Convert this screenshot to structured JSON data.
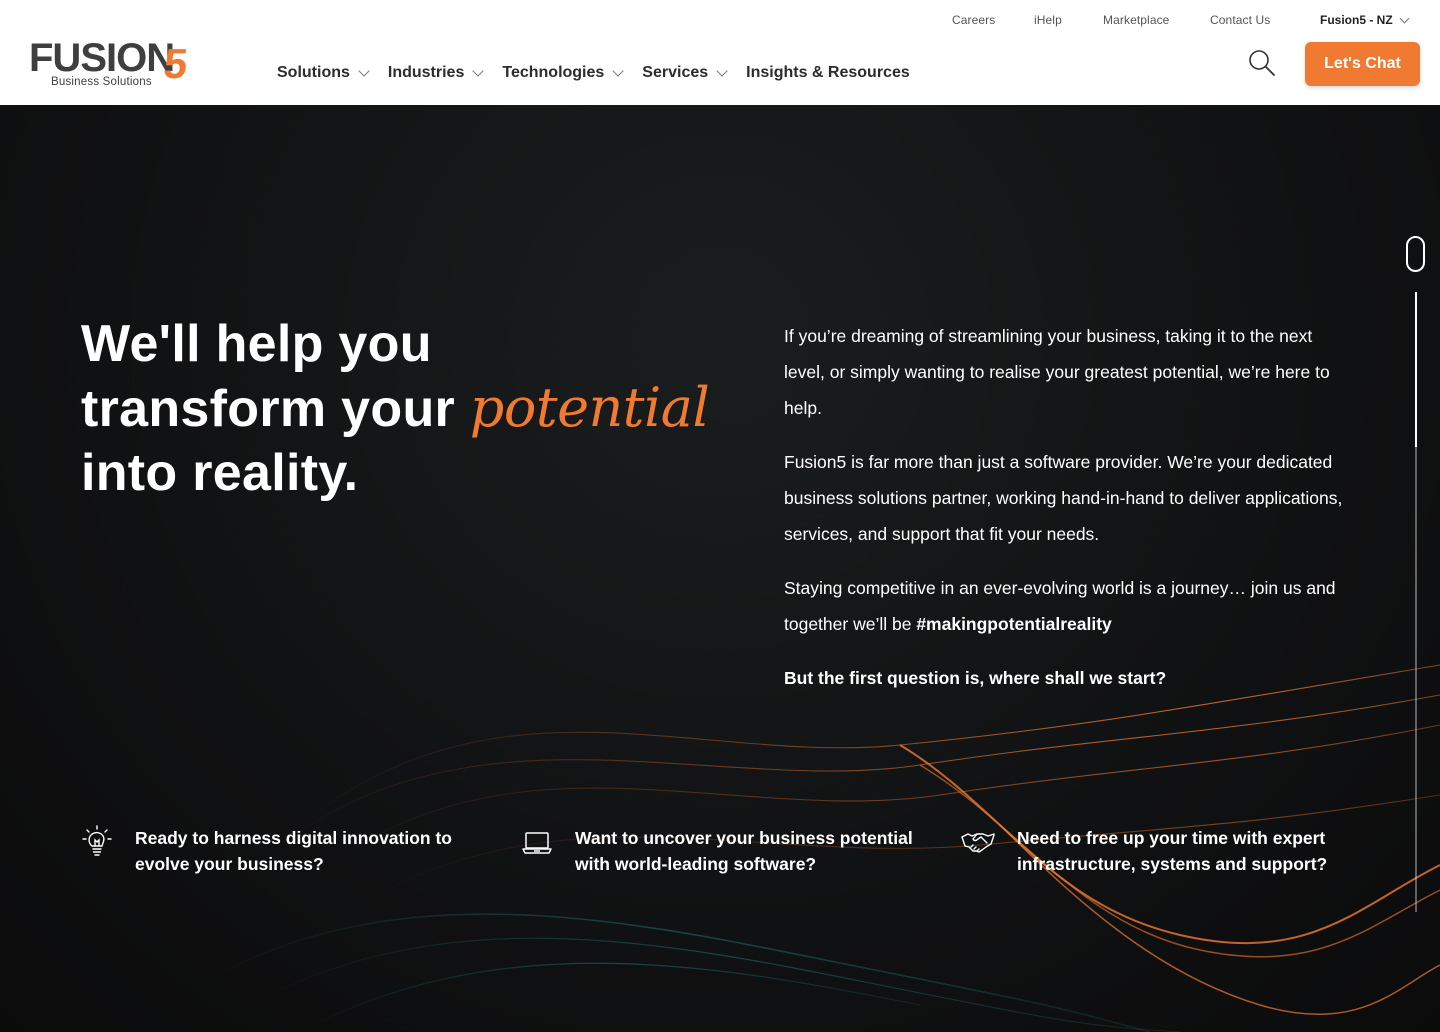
{
  "brand": {
    "logo_main": "FUSION",
    "logo_five": "5",
    "logo_sub": "Business Solutions",
    "accent_color": "#f07a32"
  },
  "utility_nav": {
    "careers": "Careers",
    "ihelp": "iHelp",
    "marketplace": "Marketplace",
    "contact": "Contact Us",
    "region": "Fusion5 - NZ"
  },
  "main_nav": {
    "solutions": "Solutions",
    "industries": "Industries",
    "technologies": "Technologies",
    "services": "Services",
    "insights": "Insights & Resources"
  },
  "header_actions": {
    "search_icon": "search-icon",
    "chat_label": "Let's Chat"
  },
  "hero": {
    "headline_line1": "We'll help you",
    "headline_line2": "transform your",
    "headline_script": "potential",
    "headline_line3": "into reality.",
    "para1": "If you’re dreaming of streamlining your business, taking it to the next level, or simply wanting to realise your greatest potential, we’re here to help.",
    "para2": "Fusion5 is far more than just a software provider. We’re your dedicated business solutions partner, working hand-in-hand to deliver applications, services, and support that fit your needs.",
    "para3_prefix": "Staying competitive in an ever-evolving world is a journey… join us and together we’ll be ",
    "para3_hashtag": "#makingpotentialreality",
    "question": "But the first question is, where shall we start?"
  },
  "features": [
    {
      "icon": "lightbulb-icon",
      "text": "Ready to harness digital innovation to evolve your business?"
    },
    {
      "icon": "laptop-icon",
      "text": "Want to uncover your business potential with world-leading software?"
    },
    {
      "icon": "handshake-icon",
      "text": "Need to free up your time with expert infrastructure, systems and support?"
    }
  ]
}
